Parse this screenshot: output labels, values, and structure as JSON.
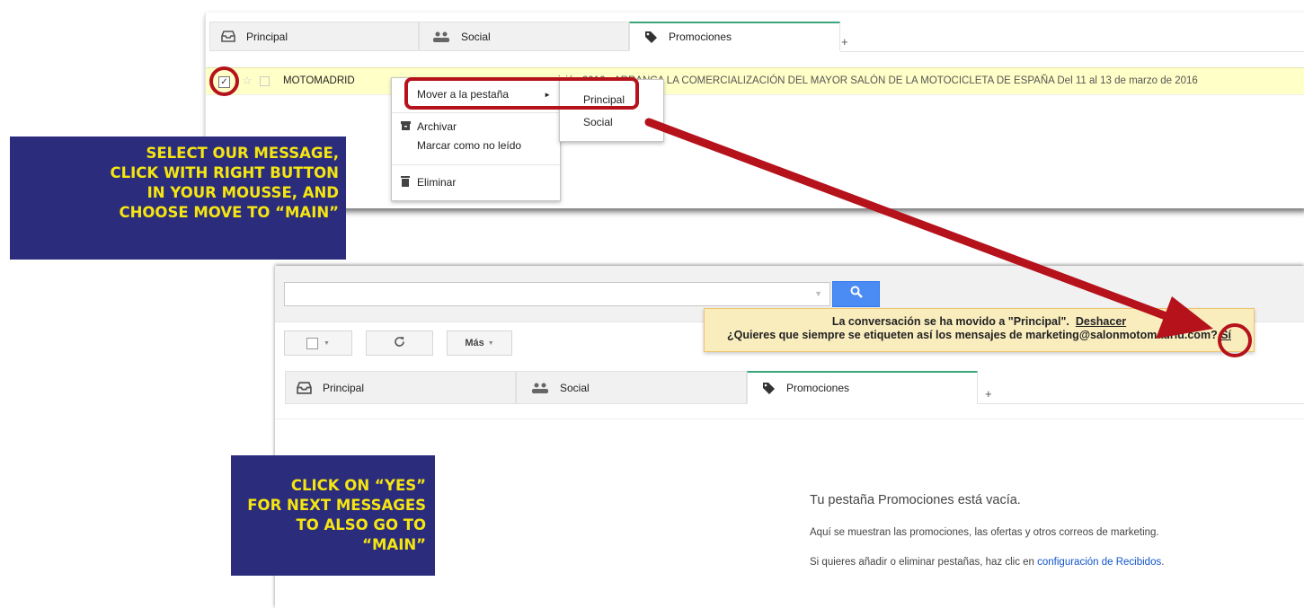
{
  "shot1": {
    "tabs": [
      {
        "label": "Principal",
        "icon": "inbox-icon"
      },
      {
        "label": "Social",
        "icon": "people-icon"
      },
      {
        "label": "Promociones",
        "icon": "tag-icon"
      }
    ],
    "add_tab": "+",
    "row": {
      "sender": "MOTOMADRID",
      "snippet": "ición 2016 - ARRANCA LA COMERCIALIZACIÓN DEL MAYOR SALÓN DE LA MOTOCICLETA DE ESPAÑA Del 11 al 13 de marzo de 2016"
    },
    "context_menu": {
      "move_to_tab": "Mover a la pestaña",
      "archive": "Archivar",
      "mark_unread": "Marcar como no leído",
      "delete": "Eliminar"
    },
    "submenu": [
      "Principal",
      "Social"
    ]
  },
  "shot2": {
    "toolbar": {
      "more_label": "Más"
    },
    "notice": {
      "line1": "La conversación se ha movido a \"Principal\".",
      "undo": "Deshacer",
      "line2": "¿Quieres que siempre se etiqueten así los mensajes de marketing@salonmotomadrid.com",
      "line2_end": "?",
      "yes": "Sí"
    },
    "tabs": [
      {
        "label": "Principal",
        "icon": "inbox-icon"
      },
      {
        "label": "Social",
        "icon": "people-icon"
      },
      {
        "label": "Promociones",
        "icon": "tag-icon"
      }
    ],
    "add_tab": "+",
    "empty": {
      "title": "Tu pestaña Promociones está vacía.",
      "desc": "Aquí se muestran las promociones, las ofertas y otros correos de marketing.",
      "settings_prefix": "Si quieres añadir o eliminar pestañas, haz clic en ",
      "settings_link": "configuración de Recibidos",
      "settings_suffix": "."
    }
  },
  "callouts": {
    "first": [
      "Select our message,",
      "click with right button",
      "in your mousse, and",
      "choose move to “Main”"
    ],
    "second": [
      "Click on “Yes”",
      "for next messages",
      "to also go to “Main”"
    ]
  },
  "colors": {
    "callout_bg": "#2b2c7c",
    "callout_text": "#f5e611",
    "highlight": "#b5121b",
    "active_tab": "#3aa57a",
    "search_button": "#4b8bf4",
    "notice_bg": "#f9edbe"
  }
}
